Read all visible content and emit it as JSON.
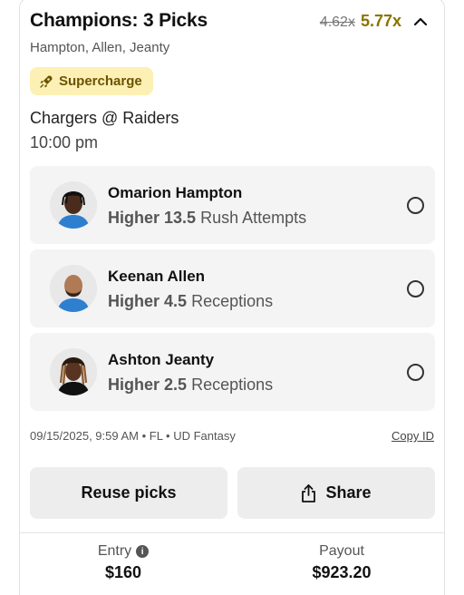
{
  "header": {
    "title": "Champions: 3 Picks",
    "multiplier_old": "4.62x",
    "multiplier_new": "5.77x",
    "collapse_icon": "chevron-up-icon"
  },
  "players_summary": "Hampton, Allen, Jeanty",
  "badge": {
    "label": "Supercharge",
    "icon": "rocket-icon",
    "bg_color": "#fcf0b4",
    "text_color": "#6b5300"
  },
  "game": {
    "matchup": "Chargers @ Raiders",
    "time": "10:00 pm"
  },
  "picks": [
    {
      "name": "Omarion Hampton",
      "direction": "Higher",
      "line": "13.5",
      "stat": "Rush Attempts",
      "avatar_icon": "player-headshot-icon"
    },
    {
      "name": "Keenan Allen",
      "direction": "Higher",
      "line": "4.5",
      "stat": "Receptions",
      "avatar_icon": "player-headshot-icon"
    },
    {
      "name": "Ashton Jeanty",
      "direction": "Higher",
      "line": "2.5",
      "stat": "Receptions",
      "avatar_icon": "player-headshot-icon"
    }
  ],
  "meta": {
    "info": "09/15/2025, 9:59 AM • FL • UD Fantasy",
    "copy_id_label": "Copy ID"
  },
  "actions": {
    "reuse_label": "Reuse picks",
    "share_label": "Share"
  },
  "footer": {
    "entry_label": "Entry",
    "entry_value": "$160",
    "payout_label": "Payout",
    "payout_value": "$923.20"
  },
  "colors": {
    "accent_gold": "#8a7300",
    "card_bg": "#f4f4f4",
    "button_bg": "#ededed"
  }
}
